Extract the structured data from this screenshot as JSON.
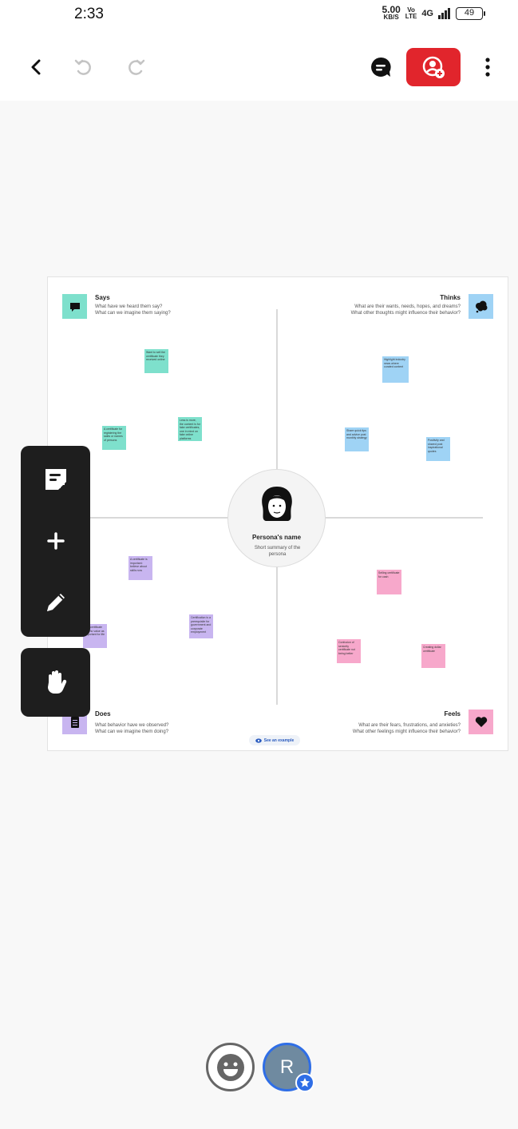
{
  "status_bar": {
    "time": "2:33",
    "net_speed_value": "5.00",
    "net_speed_unit": "KB/S",
    "volte_top": "Vo",
    "volte_bottom": "LTE",
    "network": "4G",
    "battery": "49"
  },
  "toolbar": {
    "back_icon": "chevron-left-icon",
    "undo_icon": "undo-icon",
    "redo_icon": "redo-icon",
    "comment_icon": "comment-icon",
    "share_icon": "add-user-icon",
    "more_icon": "more-vertical-icon",
    "accent_color": "#e1252c"
  },
  "board": {
    "center": {
      "name": "Persona's name",
      "summary": "Short summary of the persona"
    },
    "quadrants": {
      "says": {
        "title": "Says",
        "q1": "What have we heard them say?",
        "q2": "What can we imagine them saying?",
        "icon": "speech-bubble-icon",
        "color": "#7ee0cc"
      },
      "thinks": {
        "title": "Thinks",
        "q1": "What are their wants, needs, hopes, and dreams?",
        "q2": "What other thoughts might influence their behavior?",
        "icon": "thought-cloud-icon",
        "color": "#9fd3f5"
      },
      "does": {
        "title": "Does",
        "q1": "What behavior have we observed?",
        "q2": "What can we imagine them doing?",
        "icon": "clipboard-icon",
        "color": "#c8b5f0"
      },
      "feels": {
        "title": "Feels",
        "q1": "What are their fears, frustrations, and anxieties?",
        "q2": "What other feelings might influence their behavior?",
        "icon": "heart-icon",
        "color": "#f7a8cb"
      }
    },
    "stickies": {
      "s1": "Want to sell the certificate they received online",
      "s2": "A certificate for registering the sales or names of persons",
      "s3": "Less is more, the content is for fake certificates, one in mind on fake online platforms",
      "t1": "Highlight industry news where curated content",
      "t2": "Share quick tips and advice post monthly strategy",
      "t3": "Positivity and shared post inspirational quotes",
      "d1": "A certificate is important: believe about skills now",
      "d2": "The certificate has no value as important for life",
      "d3": "Certification is a prerequisite for government and corporate employment",
      "f1": "Selling certificate for cash",
      "f2": "Confusion of seniority certificate not being better",
      "f3": "Creating dollar certificate"
    },
    "example_link": "See an example"
  },
  "tools": {
    "sticky_note": "sticky-note-icon",
    "add": "plus-icon",
    "pen": "pencil-icon",
    "hand": "hand-icon"
  },
  "bottom": {
    "reaction_icon": "smiley-icon",
    "avatar_initial": "R",
    "avatar_badge_icon": "star-icon"
  }
}
